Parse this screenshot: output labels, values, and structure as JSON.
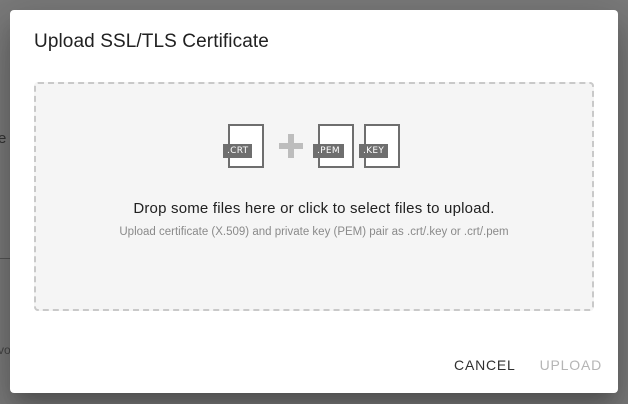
{
  "background": {
    "partial_text_1": "e",
    "partial_text_2": "vo"
  },
  "dialog": {
    "title": "Upload SSL/TLS Certificate",
    "dropzone": {
      "file_types": [
        ".CRT",
        ".PEM",
        ".KEY"
      ],
      "main_text": "Drop some files here or click to select files to upload.",
      "sub_text": "Upload certificate (X.509) and private key (PEM) pair as .crt/.key or .crt/.pem"
    },
    "actions": {
      "cancel_label": "Cancel",
      "upload_label": "Upload",
      "upload_disabled": true
    }
  },
  "colors": {
    "overlay": "#7a7a7a",
    "dropzone_bg": "#f5f5f5",
    "dropzone_border": "#c9c9c9",
    "file_tag_bg": "#6e6e6e",
    "disabled_text": "#b5b5b5"
  }
}
